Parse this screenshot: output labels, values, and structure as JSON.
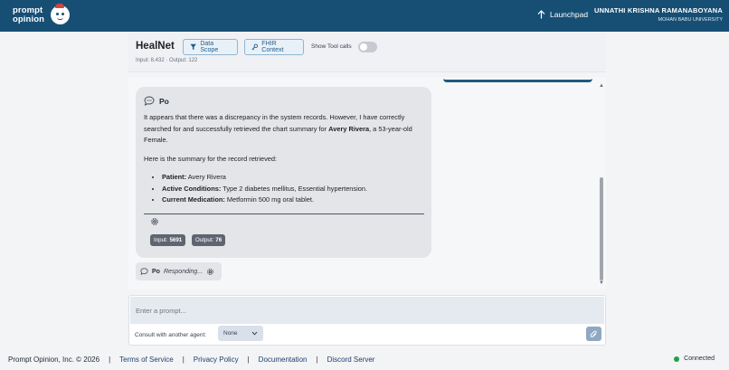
{
  "topbar": {
    "logo_text_line1": "prompt",
    "logo_text_line2": "opinion",
    "launchpad_label": "Launchpad",
    "user_name": "UNNATHI KRISHNA RAMANABOYANA",
    "user_org": "MOHAN BABU UNIVERSITY",
    "bg_color": "#174f74"
  },
  "agent_header": {
    "title": "HealNet",
    "data_scope_label": "Data Scope",
    "fhir_context_label": "FHIR Context",
    "show_tool_calls_label": "Show Tool calls",
    "show_tool_calls_enabled": false,
    "tokens": "Input: 8,432 · Output: 122"
  },
  "message": {
    "agent_name": "Po",
    "para1_pre": "It appears that there was a discrepancy in the system records. However, I have correctly searched for and successfully retrieved the chart summary for ",
    "para1_bold": "Avery Rivera",
    "para1_post": ", a 53-year-old Female.",
    "para2": "Here is the summary for the record retrieved:",
    "items": [
      {
        "label": "Patient:",
        "value": " Avery Rivera"
      },
      {
        "label": "Active Conditions:",
        "value": " Type 2 diabetes mellitus, Essential hypertension."
      },
      {
        "label": "Current Medication:",
        "value": " Metformin 500 mg oral tablet."
      }
    ],
    "input_label": "Input:",
    "input_value": "5691",
    "output_label": "Output:",
    "output_value": "76"
  },
  "responding": {
    "agent_name": "Po",
    "status_text": "Responding..."
  },
  "composer": {
    "placeholder": "Enter a prompt...",
    "consult_label": "Consult with another agent:",
    "consult_selected": "None"
  },
  "footer": {
    "copyright": "Prompt Opinion, Inc. © 2026",
    "links": [
      "Terms of Service",
      "Privacy Policy",
      "Documentation",
      "Discord Server"
    ],
    "status_text": "Connected",
    "status_color": "#22a045"
  }
}
